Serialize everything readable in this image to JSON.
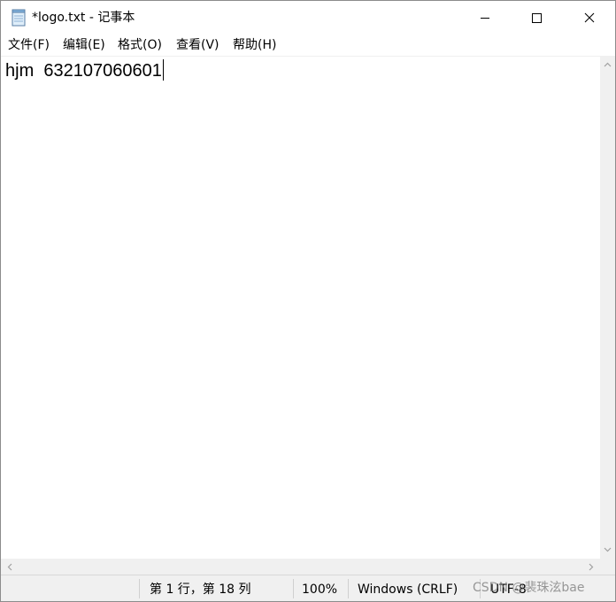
{
  "window": {
    "title": "*logo.txt - 记事本",
    "app_icon": "notepad-icon",
    "controls": {
      "minimize_icon": "minimize-icon",
      "maximize_icon": "maximize-icon",
      "close_icon": "close-icon"
    }
  },
  "menu": {
    "items": [
      {
        "label": "文件(F)"
      },
      {
        "label": "编辑(E)"
      },
      {
        "label": "格式(O)"
      },
      {
        "label": "查看(V)"
      },
      {
        "label": "帮助(H)"
      }
    ]
  },
  "editor": {
    "content": "hjm  632107060601"
  },
  "status": {
    "position": "第 1 行，第 18 列",
    "zoom": "100%",
    "line_ending": "Windows (CRLF)",
    "encoding": "UTF-8",
    "watermark": "CSDN @裴珠泫bae"
  },
  "colors": {
    "chrome_bg": "#f0f0f0",
    "editor_bg": "#ffffff",
    "text": "#000000"
  }
}
